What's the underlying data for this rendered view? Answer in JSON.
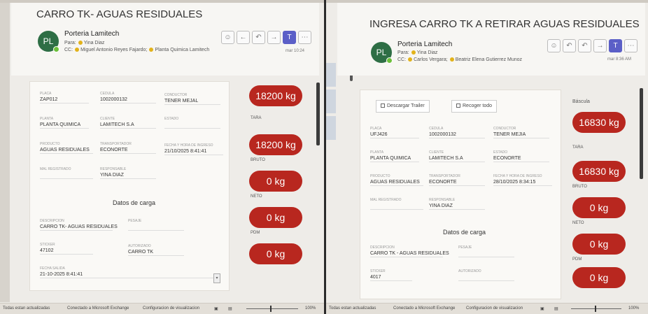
{
  "left": {
    "subject": "CARRO TK- AGUAS RESIDUALES",
    "avatar_initials": "PL",
    "sender": "Porteria Lamitech",
    "para_label": "Para:",
    "para_value": "Yina Diaz",
    "cc_label": "CC:",
    "cc_1": "Miguel Antonio Reyes Fajardo;",
    "cc_2": "Planta Quimica Lamitech",
    "timestamp": "mar 10:24",
    "fields": {
      "placa": {
        "label": "PLACA",
        "value": "ZAP012"
      },
      "cedula": {
        "label": "CEDULA",
        "value": "1002000132"
      },
      "conductor": {
        "label": "CONDUCTOR",
        "value": "TENER MEJAL"
      },
      "planta": {
        "label": "PLANTA",
        "value": "PLANTA QUIMICA"
      },
      "cliente": {
        "label": "CLIENTE",
        "value": "LAMITECH S.A"
      },
      "estado": {
        "label": "ESTADO",
        "value": ""
      },
      "producto": {
        "label": "PRODUCTO",
        "value": "AGUAS RESIDUALES"
      },
      "transportador": {
        "label": "TRANSPORTADOR",
        "value": "ECONORTE"
      },
      "fecha_hora": {
        "label": "FECHA Y HORA DE INGRESO",
        "value": "21/10/2025 8:41:41"
      },
      "mal_registrado": {
        "label": "MAL REGISTRADO",
        "value": ""
      },
      "responsable": {
        "label": "RESPONSABLE",
        "value": "YINA DIAZ"
      }
    },
    "carga_title": "Datos de carga",
    "carga": {
      "descripcion": {
        "label": "DESCRIPCION",
        "value": "CARRO TK- AGUAS RESIDUALES"
      },
      "pesaje": {
        "label": "PESAJE",
        "value": ""
      },
      "sticker": {
        "label": "STICKER",
        "value": "47102"
      },
      "autorizado": {
        "label": "AUTORIZADO",
        "value": "CARRO TK"
      },
      "fecha_salida": {
        "label": "FECHA SALIDA",
        "value": "21-10-2025 8:41:41"
      }
    },
    "weights": [
      {
        "value": "18200 kg",
        "label": "TARA"
      },
      {
        "value": "18200 kg",
        "label": "BRUTO"
      },
      {
        "value": "0 kg",
        "label": "NETO"
      },
      {
        "value": "0 kg",
        "label": "PDM"
      },
      {
        "value": "0 kg",
        "label": ""
      }
    ],
    "status": {
      "filter": "Todas estan actualizadas",
      "connection": "Conectado a Microsoft Exchange",
      "display_settings": "Configuracion de visualizacion",
      "zoom": "100%"
    }
  },
  "right": {
    "subject": "INGRESA CARRO TK  A  RETIRAR AGUAS RESIDUALES",
    "avatar_initials": "PL",
    "sender": "Porteria Lamitech",
    "para_label": "Para:",
    "para_value": "Yina Diaz",
    "cc_label": "CC:",
    "cc_1": "Carlos Vergara;",
    "cc_2": "Beatriz Elena Gutierrez Munoz",
    "timestamp": "mar 8:36 AM",
    "checkbox_1": "Descargar Trailer",
    "checkbox_2": "Recoger todo",
    "bascula_label": "Báscula",
    "fields": {
      "placa": {
        "label": "PLACA",
        "value": "UFJ426"
      },
      "cedula": {
        "label": "CEDULA",
        "value": "1002000132"
      },
      "conductor": {
        "label": "CONDUCTOR",
        "value": "TENER MEJIA"
      },
      "planta": {
        "label": "PLANTA",
        "value": "PLANTA QUIMICA"
      },
      "cliente": {
        "label": "CLIENTE",
        "value": "LAMITECH S.A"
      },
      "estado": {
        "label": "ESTADO",
        "value": "ECONORTE"
      },
      "producto": {
        "label": "PRODUCTO",
        "value": "AGUAS RESIDUALES"
      },
      "transportador": {
        "label": "TRANSPORTADOR",
        "value": "ECONORTE"
      },
      "fecha_hora": {
        "label": "FECHA Y HORA DE INGRESO",
        "value": "28/10/2025 8:34:15"
      },
      "mal_registrado": {
        "label": "MAL REGISTRADO",
        "value": ""
      },
      "responsable": {
        "label": "RESPONSABLE",
        "value": "YINA DIAZ"
      }
    },
    "carga_title": "Datos de carga",
    "carga": {
      "descripcion": {
        "label": "DESCRIPCION",
        "value": "CARRO TK - AGUAS RESIDUALES"
      },
      "pesaje": {
        "label": "PESAJE",
        "value": ""
      },
      "sticker": {
        "label": "STICKER",
        "value": "4017"
      },
      "autorizado": {
        "label": "AUTORIZADO",
        "value": ""
      }
    },
    "weights": [
      {
        "value": "16830 kg",
        "label": "TARA"
      },
      {
        "value": "16830 kg",
        "label": "BRUTO"
      },
      {
        "value": "0 kg",
        "label": "NETO"
      },
      {
        "value": "0 kg",
        "label": "PDM"
      },
      {
        "value": "0 kg",
        "label": ""
      }
    ],
    "status": {
      "filter": "Todas estan actualizadas",
      "connection": "Conectado a Microsoft Exchange",
      "display_settings": "Configuracion de visualizacion",
      "zoom": "100%"
    }
  },
  "colors": {
    "weight_pill": "#b8271f",
    "avatar": "#2e6e45",
    "presence": "#e2b21a",
    "teams": "#5b5fc7"
  },
  "icons": [
    "reply-icon",
    "reply-all-icon",
    "forward-icon",
    "teams-icon",
    "more-icon",
    "emoji-icon"
  ]
}
